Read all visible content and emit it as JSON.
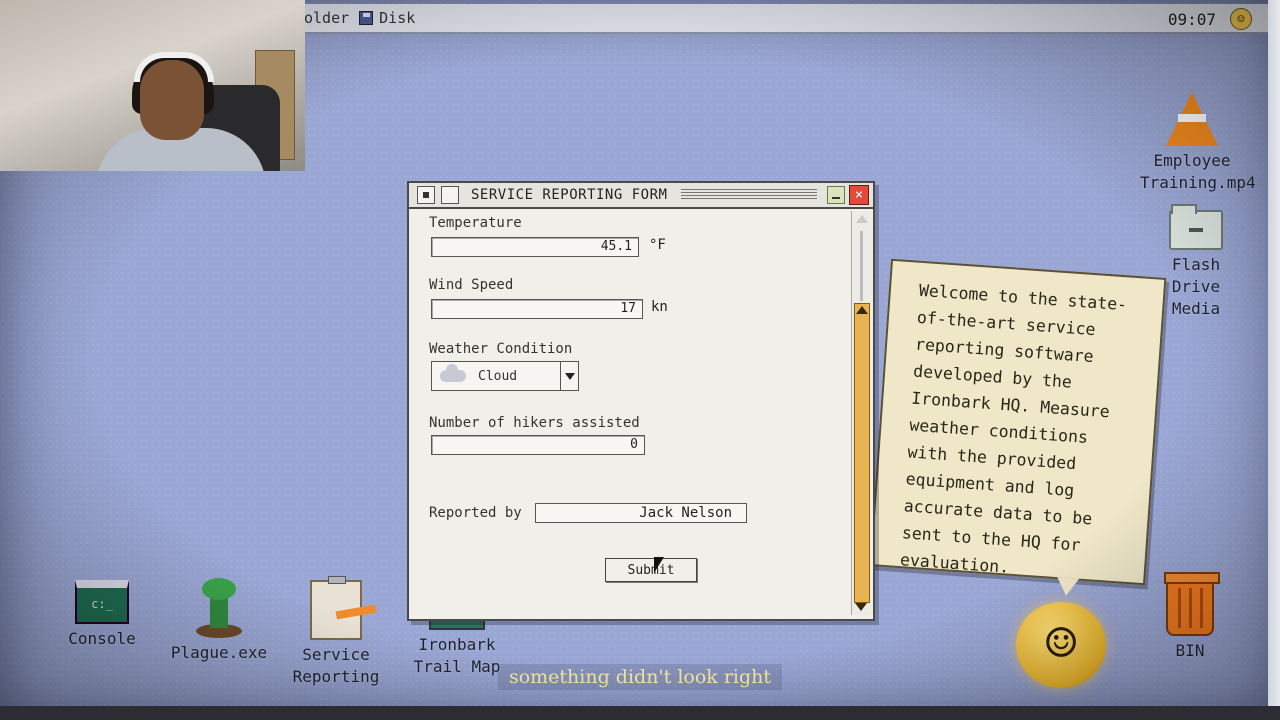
{
  "menubar": {
    "items": [
      {
        "label": "older",
        "icon": "folder-icon"
      },
      {
        "label": "Disk",
        "icon": "disk-icon"
      }
    ],
    "clock": "09:07",
    "status_icon": "smiley-icon"
  },
  "desktop_icons": [
    {
      "label": "Console",
      "icon": "console-icon"
    },
    {
      "label": "Plague.exe",
      "icon": "plant-icon"
    },
    {
      "label": "Service Reporting",
      "icon": "clipboard-icon"
    },
    {
      "label": "Ironbark Trail Map",
      "icon": "map-icon"
    },
    {
      "label": "Employee Training.mp4",
      "icon": "traffic-cone-icon"
    },
    {
      "label": "Flash Drive Media",
      "icon": "folder-icon"
    },
    {
      "label": "BIN",
      "icon": "trash-bin-icon"
    }
  ],
  "note": {
    "text": "Welcome to the state-of-the-art service reporting software developed by the Ironbark HQ. Measure weather conditions with the provided equipment and log accurate data to be sent to the HQ for evaluation."
  },
  "window": {
    "title": "SERVICE REPORTING FORM",
    "form": {
      "temperature": {
        "label": "Temperature",
        "value": "45.1",
        "unit": "°F"
      },
      "wind_speed": {
        "label": "Wind Speed",
        "value": "17",
        "unit": "kn"
      },
      "weather": {
        "label": "Weather Condition",
        "value": "Cloud",
        "icon": "cloud-icon"
      },
      "hikers": {
        "label": "Number of hikers assisted",
        "value": "0"
      },
      "reporter": {
        "label": "Reported by",
        "value": "Jack Nelson"
      },
      "submit_label": "Submit"
    }
  },
  "subtitle": "something didn't look right",
  "colors": {
    "desktop": "#9aa6d3",
    "window_bg": "#f1efe9",
    "scroll_thumb": "#e7b453",
    "close_button": "#e24a3a",
    "note_bg": "#efe7c7",
    "subtitle_text": "#f4e79a"
  }
}
